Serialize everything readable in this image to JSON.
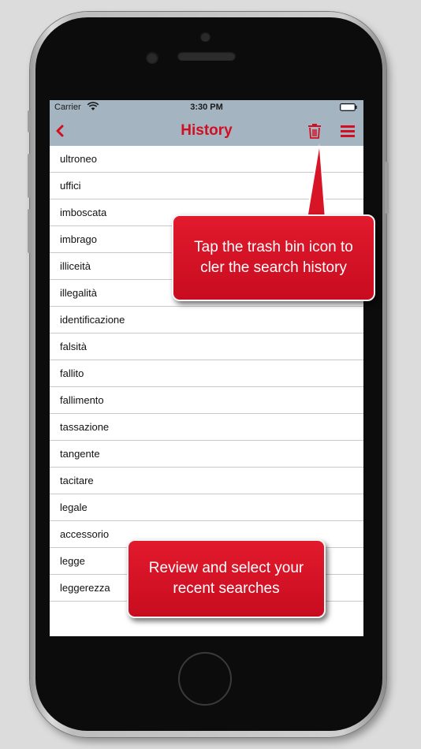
{
  "status_bar": {
    "carrier": "Carrier",
    "time": "3:30 PM"
  },
  "nav": {
    "title": "History",
    "back_icon": "chevron-left-icon",
    "trash_icon": "trash-icon",
    "menu_icon": "hamburger-menu-icon"
  },
  "history": {
    "items": [
      "ultroneo",
      "uffici",
      "imboscata",
      "imbrago",
      "illiceità",
      "illegalità",
      "identificazione",
      "falsità",
      "fallito",
      "fallimento",
      "tassazione",
      "tangente",
      "tacitare",
      "legale",
      "accessorio",
      "legge",
      "leggerezza"
    ]
  },
  "callouts": {
    "trash_hint": "Tap the trash bin icon to cler the search history",
    "list_hint": "Review and select your recent searches"
  },
  "colors": {
    "accent": "#d20f22",
    "nav_bar": "#a4b4c0",
    "callout": "#d81427"
  }
}
